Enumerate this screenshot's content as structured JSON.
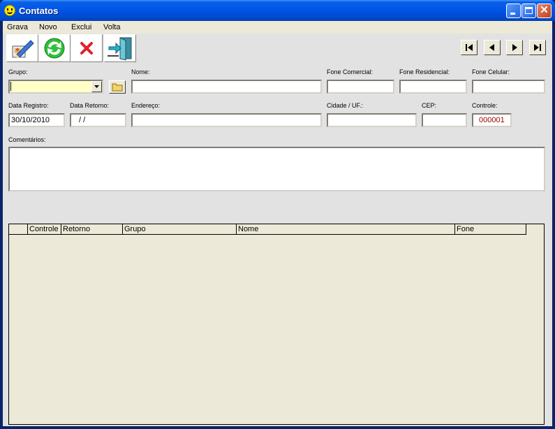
{
  "window": {
    "title": "Contatos"
  },
  "menu": [
    "Grava",
    "Novo",
    "Exclui",
    "Volta"
  ],
  "toolbar": {
    "buttons": [
      "edit-icon",
      "refresh-icon",
      "delete-icon",
      "exit-icon"
    ],
    "nav": [
      "first-record-icon",
      "previous-record-icon",
      "next-record-icon",
      "last-record-icon"
    ]
  },
  "form": {
    "grupo": {
      "label": "Grupo:",
      "value": ""
    },
    "nome": {
      "label": "Nome:",
      "value": ""
    },
    "fone_comercial": {
      "label": "Fone Comercial:",
      "value": ""
    },
    "fone_residencial": {
      "label": "Fone Residencial:",
      "value": ""
    },
    "fone_celular": {
      "label": "Fone Celular:",
      "value": ""
    },
    "data_registro": {
      "label": "Data Registro:",
      "value": "30/10/2010"
    },
    "data_retorno": {
      "label": "Data Retorno:",
      "value": " / /"
    },
    "endereco": {
      "label": "Endereço:",
      "value": ""
    },
    "cidade_uf": {
      "label": "Cidade / UF.:",
      "value": ""
    },
    "cep": {
      "label": "CEP:",
      "value": ""
    },
    "controle": {
      "label": "Controle:",
      "value": "000001"
    },
    "comentarios": {
      "label": "Comentários:",
      "value": ""
    }
  },
  "grid": {
    "columns": [
      "",
      "Controle",
      "Retorno",
      "Grupo",
      "Nome",
      "Fone"
    ],
    "rows": []
  },
  "colors": {
    "titlebar": "#0054e3",
    "grupo_field": "#ffffc8",
    "controle_text": "#a00000"
  }
}
